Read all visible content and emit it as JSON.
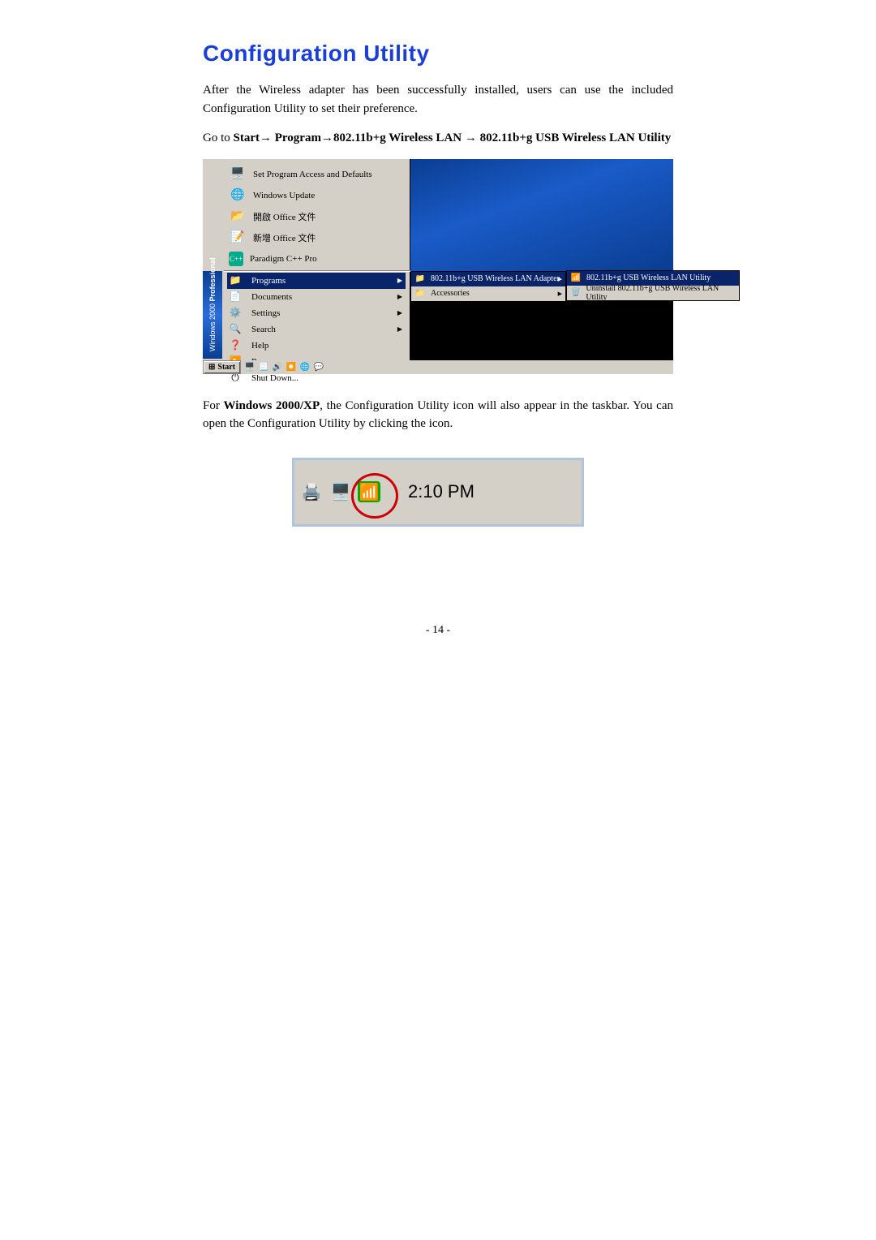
{
  "heading": "Configuration Utility",
  "intro": "After the Wireless adapter has been successfully installed, users can use the included Configuration Utility to set their preference.",
  "goto": {
    "prefix": "Go  to  ",
    "start": "Start",
    "arrow1": "→",
    "program": "Program",
    "arrow2": "→",
    "path1": "802.11b+g  Wireless  LAN",
    "arrow3": "→",
    "path2": "802.11b+g  USB Wireless LAN Utility"
  },
  "for_windows": {
    "prefix": "For ",
    "bold": "Windows 2000/XP",
    "rest": ", the Configuration Utility icon will also appear in the taskbar. You can open the Configuration Utility by clicking the icon."
  },
  "screenshot": {
    "top_items": [
      "Set Program Access and Defaults",
      "Windows Update",
      "開啟 Office 文件",
      "新增 Office 文件",
      "Paradigm C++ Pro"
    ],
    "stripe": {
      "prefix": "Windows 2000 ",
      "bold": "Professional"
    },
    "main_items": [
      {
        "label": "Programs",
        "arrow": true,
        "highlight": true
      },
      {
        "label": "Documents",
        "arrow": true
      },
      {
        "label": "Settings",
        "arrow": true
      },
      {
        "label": "Search",
        "arrow": true
      },
      {
        "label": "Help"
      },
      {
        "label": "Run..."
      },
      {
        "label": "Shut Down..."
      }
    ],
    "submenu1": [
      {
        "label": "802.11b+g USB Wireless LAN Adapter",
        "arrow": true,
        "highlight": true
      },
      {
        "label": "Accessories",
        "arrow": true
      }
    ],
    "submenu2": [
      {
        "label": "802.11b+g USB Wireless LAN Utility",
        "highlight": true
      },
      {
        "label": "Uninstall 802.11b+g USB Wireless LAN Utility"
      }
    ],
    "taskbar": {
      "start": "Start"
    }
  },
  "systray": {
    "time": "2:10 PM"
  },
  "page_number": "- 14 -",
  "colors": {
    "heading": "#1a3fd8",
    "highlight_bg": "#0a246a"
  }
}
